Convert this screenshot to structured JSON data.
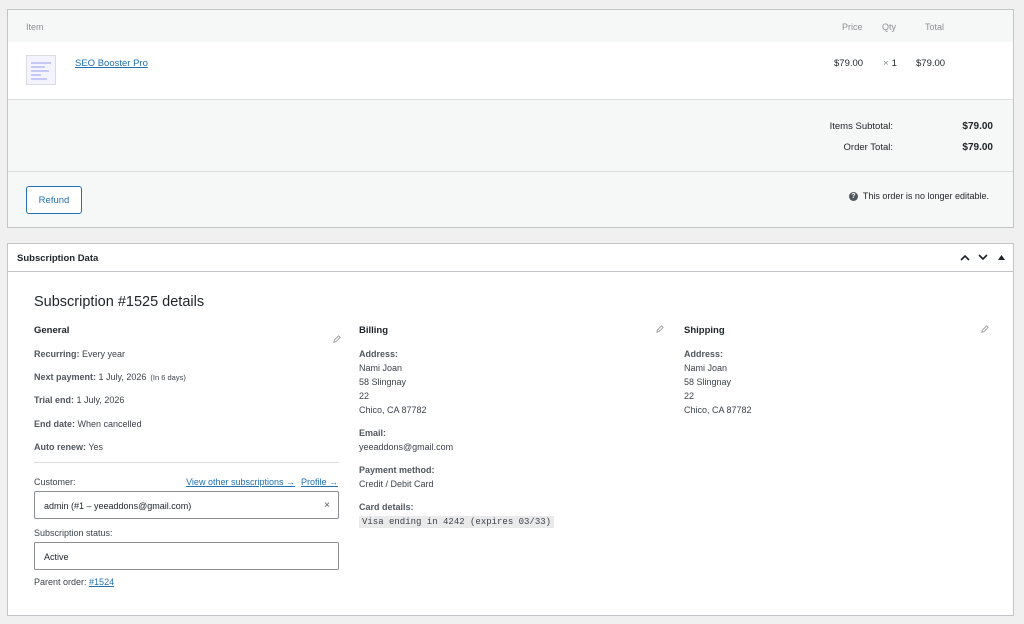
{
  "items_table": {
    "headers": {
      "item": "Item",
      "price": "Price",
      "qty": "Qty",
      "total": "Total"
    },
    "rows": [
      {
        "name": "SEO Booster Pro",
        "price": "$79.00",
        "qty_prefix": "×",
        "qty": "1",
        "total": "$79.00"
      }
    ]
  },
  "totals": {
    "items_subtotal_label": "Items Subtotal:",
    "items_subtotal_value": "$79.00",
    "order_total_label": "Order Total:",
    "order_total_value": "$79.00"
  },
  "actions": {
    "refund_label": "Refund",
    "not_editable_text": "This order is no longer editable."
  },
  "subscription": {
    "panel_title": "Subscription Data",
    "title": "Subscription #1525 details",
    "general": {
      "heading": "General",
      "recurring_label": "Recurring:",
      "recurring_value": "Every year",
      "next_payment_label": "Next payment:",
      "next_payment_value": "1 July, 2026",
      "next_payment_note": "(In 6 days)",
      "trial_end_label": "Trial end:",
      "trial_end_value": "1 July, 2026",
      "end_date_label": "End date:",
      "end_date_value": "When cancelled",
      "auto_renew_label": "Auto renew:",
      "auto_renew_value": "Yes",
      "customer_label": "Customer:",
      "view_other_link": "View other subscriptions →",
      "profile_link": "Profile →",
      "customer_value": "admin (#1 – yeeaddons@gmail.com)",
      "clear_symbol": "×",
      "status_label": "Subscription status:",
      "status_value": "Active",
      "parent_order_label": "Parent order:",
      "parent_order_link": "#1524"
    },
    "billing": {
      "heading": "Billing",
      "address_label": "Address:",
      "address_lines": [
        "Nami Joan",
        "58 Slingnay",
        "22",
        "Chico, CA 87782"
      ],
      "email_label": "Email:",
      "email_value": "yeeaddons@gmail.com",
      "payment_method_label": "Payment method:",
      "payment_method_value": "Credit / Debit Card",
      "card_details_label": "Card details:",
      "card_details_value": "Visa ending in 4242 (expires 03/33)"
    },
    "shipping": {
      "heading": "Shipping",
      "address_label": "Address:",
      "address_lines": [
        "Nami Joan",
        "58 Slingnay",
        "22",
        "Chico, CA 87782"
      ]
    }
  },
  "icons": {
    "help": "help-icon",
    "pencil": "pencil-icon",
    "collapse_up": "chevron-up-icon",
    "collapse_down": "chevron-down-icon",
    "toggle": "caret-up-icon"
  },
  "colors": {
    "link": "#2271b1",
    "border": "#c3c4c7",
    "bg": "#f0f0f1"
  }
}
